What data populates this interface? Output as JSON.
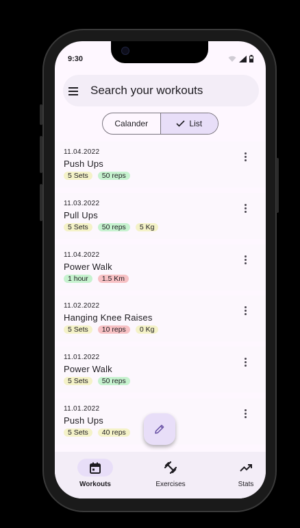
{
  "status_bar": {
    "time": "9:30",
    "icons": [
      "wifi-icon",
      "signal-icon",
      "battery-icon"
    ]
  },
  "search": {
    "placeholder": "Search your workouts",
    "menu_icon": "menu-icon"
  },
  "view_toggle": {
    "options": [
      {
        "label": "Calander",
        "selected": false
      },
      {
        "label": "List",
        "selected": true
      }
    ]
  },
  "workouts": [
    {
      "date": "11.04.2022",
      "name": "Push Ups",
      "tags": [
        {
          "text": "5 Sets",
          "color": "yellow"
        },
        {
          "text": "50 reps",
          "color": "green"
        }
      ]
    },
    {
      "date": "11.03.2022",
      "name": "Pull Ups",
      "tags": [
        {
          "text": "5 Sets",
          "color": "yellow"
        },
        {
          "text": "50 reps",
          "color": "green"
        },
        {
          "text": "5 Kg",
          "color": "yellow"
        }
      ]
    },
    {
      "date": "11.04.2022",
      "name": "Power Walk",
      "tags": [
        {
          "text": "1 hour",
          "color": "green"
        },
        {
          "text": "1.5 Km",
          "color": "red"
        }
      ]
    },
    {
      "date": "11.02.2022",
      "name": "Hanging Knee Raises",
      "tags": [
        {
          "text": "5 Sets",
          "color": "yellow"
        },
        {
          "text": "10 reps",
          "color": "red"
        },
        {
          "text": "0 Kg",
          "color": "yellow"
        }
      ]
    },
    {
      "date": "11.01.2022",
      "name": "Power Walk",
      "tags": [
        {
          "text": "5 Sets",
          "color": "yellow"
        },
        {
          "text": "50 reps",
          "color": "green"
        }
      ]
    },
    {
      "date": "11.01.2022",
      "name": "Push Ups",
      "tags": [
        {
          "text": "5 Sets",
          "color": "yellow"
        },
        {
          "text": "40 reps",
          "color": "yellow"
        }
      ]
    }
  ],
  "fab": {
    "icon": "pencil-icon"
  },
  "nav": {
    "items": [
      {
        "label": "Workouts",
        "icon": "calendar-icon",
        "active": true
      },
      {
        "label": "Exercises",
        "icon": "dumbbell-icon",
        "active": false
      },
      {
        "label": "Stats",
        "icon": "trending-up-icon",
        "active": false
      }
    ]
  },
  "colors": {
    "surface": "#fef7ff",
    "secondary_container": "#e8def8",
    "tag_green": "#c6f2cf",
    "tag_red": "#f7c1c4",
    "tag_yellow": "#f4f2c8"
  }
}
